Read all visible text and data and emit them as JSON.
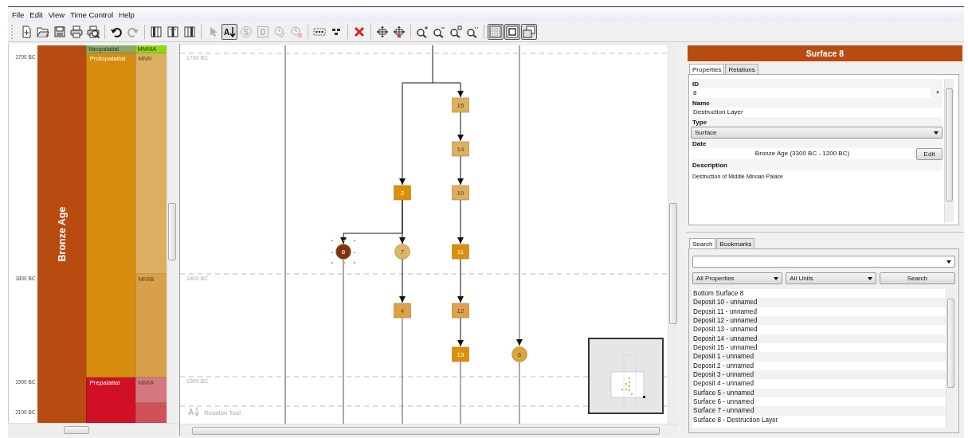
{
  "menu": [
    "File",
    "Edit",
    "View",
    "Time Control",
    "Help"
  ],
  "toolbar": [
    [
      {
        "kind": "new",
        "selected": false,
        "disabled": false
      },
      {
        "kind": "open",
        "selected": false,
        "disabled": false
      },
      {
        "kind": "save",
        "selected": false,
        "disabled": false
      },
      {
        "kind": "print",
        "selected": false,
        "disabled": false
      },
      {
        "kind": "preview",
        "selected": false,
        "disabled": false
      }
    ],
    [
      {
        "kind": "undo",
        "selected": false,
        "disabled": false
      },
      {
        "kind": "redo",
        "selected": false,
        "disabled": true
      }
    ],
    [
      {
        "kind": "col1",
        "selected": false,
        "disabled": false
      },
      {
        "kind": "col2",
        "selected": false,
        "disabled": false
      },
      {
        "kind": "col3",
        "selected": false,
        "disabled": false
      }
    ],
    [
      {
        "kind": "pointer",
        "selected": false,
        "disabled": true
      },
      {
        "kind": "relation",
        "glyph": "A",
        "selected": true,
        "disabled": false
      },
      {
        "kind": "scircle",
        "glyph": "S",
        "selected": false,
        "disabled": true
      },
      {
        "kind": "dsquare",
        "glyph": "D",
        "selected": false,
        "disabled": true
      },
      {
        "kind": "clockcheck",
        "selected": false,
        "disabled": true
      },
      {
        "kind": "clockx",
        "selected": false,
        "disabled": true
      }
    ],
    [
      {
        "kind": "dots",
        "selected": false,
        "disabled": false
      },
      {
        "kind": "cluster",
        "selected": false,
        "disabled": false
      }
    ],
    [
      {
        "kind": "delete",
        "selected": false,
        "disabled": false
      }
    ],
    [
      {
        "kind": "move",
        "selected": false,
        "disabled": false
      },
      {
        "kind": "movered",
        "selected": false,
        "disabled": false
      }
    ],
    [
      {
        "kind": "zoomin",
        "selected": false,
        "disabled": false
      },
      {
        "kind": "zoomout",
        "selected": false,
        "disabled": false
      },
      {
        "kind": "zoomfit",
        "selected": false,
        "disabled": false
      },
      {
        "kind": "zoomreset",
        "selected": false,
        "disabled": false
      }
    ],
    [
      {
        "kind": "grid",
        "selected": true,
        "disabled": false
      },
      {
        "kind": "frame",
        "selected": true,
        "disabled": false
      },
      {
        "kind": "windows",
        "selected": true,
        "disabled": false
      }
    ]
  ],
  "timeline": {
    "ticks": [
      "1700 BC",
      "1800 BC",
      "1900 BC",
      "2100 BC"
    ],
    "age": {
      "label": "Bronze Age",
      "color": "#b84c10"
    },
    "periods": [
      {
        "label": "Neopalatial",
        "color": "#8fa86a"
      },
      {
        "label": "Protopalatial",
        "color": "#d68c0e"
      },
      {
        "label": "Prepalatial",
        "color": "#d01024"
      }
    ],
    "phases": [
      {
        "label": "MMIIIA",
        "color": "#8fd810"
      },
      {
        "label": "MMII",
        "color": "#dcb062"
      },
      {
        "label": "MMIB",
        "color": "#d8a048"
      },
      {
        "label": "MMIA",
        "color": "#d47880"
      },
      {
        "color": "#d25058"
      }
    ]
  },
  "diagram": {
    "ticks": [
      "1700 BC",
      "1800 BC",
      "1900 BC"
    ],
    "nodes": [
      {
        "label": "15",
        "kind": "deposit",
        "color": "#dcb062",
        "selected": false
      },
      {
        "label": "14",
        "kind": "deposit",
        "color": "#dcb062",
        "selected": false
      },
      {
        "label": "10",
        "kind": "deposit",
        "color": "#dcb062",
        "selected": false
      },
      {
        "label": "2",
        "kind": "deposit",
        "color": "#dd8f0a",
        "selected": false
      },
      {
        "label": "8",
        "kind": "surface",
        "color": "#7e3410",
        "selected": true
      },
      {
        "label": "7",
        "kind": "surface",
        "color": "#dcb46a",
        "selected": false
      },
      {
        "label": "11",
        "kind": "deposit",
        "color": "#dd8f0a",
        "selected": false
      },
      {
        "label": "4",
        "kind": "deposit",
        "color": "#dca24a",
        "selected": false
      },
      {
        "label": "12",
        "kind": "deposit",
        "color": "#dca24a",
        "selected": false
      },
      {
        "label": "13",
        "kind": "deposit",
        "color": "#dd8f0a",
        "selected": false
      },
      {
        "label": "6",
        "kind": "surface",
        "color": "#dca23c",
        "selected": false
      }
    ],
    "tool": {
      "glyph": "A",
      "label": "Relation Tool"
    }
  },
  "details": {
    "title": "Surface 8",
    "tabs": [
      {
        "label": "Properties",
        "selected": true
      },
      {
        "label": "Relations",
        "selected": false
      }
    ],
    "id_label": "ID",
    "id": "8",
    "id_button": "*",
    "name_label": "Name",
    "name": "Destruction Layer",
    "type_label": "Type",
    "type": "Surface",
    "date_label": "Date",
    "date": "Bronze Age (3300 BC - 1200 BC)",
    "edit_button": "Edit",
    "description_label": "Description",
    "description": "Destruction of Middle Minoan Palace"
  },
  "search": {
    "tabs": [
      {
        "label": "Search",
        "selected": true
      },
      {
        "label": "Bookmarks",
        "selected": false
      }
    ],
    "property_filter": "All Properties",
    "unit_filter": "All Units",
    "button": "Search",
    "results": [
      "Bottom Surface 8",
      "Deposit 10 - unnamed",
      "Deposit 11 - unnamed",
      "Deposit 12 - unnamed",
      "Deposit 13 - unnamed",
      "Deposit 14 - unnamed",
      "Deposit 15 - unnamed",
      "Deposit 1 - unnamed",
      "Deposit 2 - unnamed",
      "Deposit 3 - unnamed",
      "Deposit 4 - unnamed",
      "Surface 5 - unnamed",
      "Surface 6 - unnamed",
      "Surface 7 - unnamed",
      "Surface 8 - Destruction Layer"
    ]
  }
}
